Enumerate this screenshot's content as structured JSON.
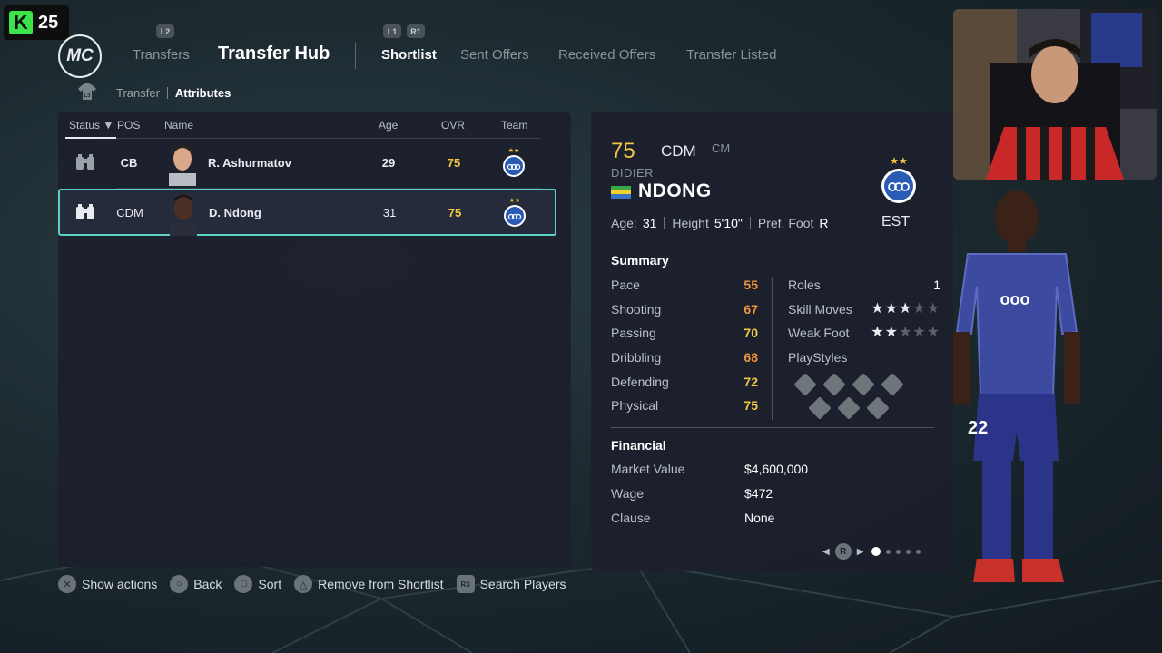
{
  "overlay": {
    "badge_number": "25"
  },
  "header": {
    "logo": "MC",
    "hint_left": "L2",
    "nav_transfers": "Transfers",
    "nav_hub": "Transfer Hub",
    "hint_l1": "L1",
    "hint_r1": "R1",
    "tabs": [
      {
        "label": "Shortlist"
      },
      {
        "label": "Sent Offers"
      },
      {
        "label": "Received Offers"
      },
      {
        "label": "Transfer Listed"
      }
    ],
    "breadcrumb_hint": "L3",
    "breadcrumb": [
      "Transfer",
      "Attributes"
    ]
  },
  "list": {
    "columns": {
      "status": "Status",
      "pos": "POS",
      "name": "Name",
      "age": "Age",
      "ovr": "OVR",
      "team": "Team"
    },
    "rows": [
      {
        "pos": "CB",
        "name": "R. Ashurmatov",
        "age": "29",
        "ovr": "75"
      },
      {
        "pos": "CDM",
        "name": "D. Ndong",
        "age": "31",
        "ovr": "75"
      }
    ]
  },
  "player": {
    "ovr": "75",
    "pos": "CDM",
    "alt_pos": "CM",
    "first_name": "DIDIER",
    "last_name": "NDONG",
    "age_label": "Age:",
    "age": "31",
    "height_label": "Height",
    "height": "5'10\"",
    "foot_label": "Pref. Foot",
    "foot": "R",
    "club": "EST",
    "shirt_number": "22",
    "summary_title": "Summary",
    "stats": [
      {
        "label": "Pace",
        "value": "55",
        "color": "#f0923a"
      },
      {
        "label": "Shooting",
        "value": "67",
        "color": "#f0923a"
      },
      {
        "label": "Passing",
        "value": "70",
        "color": "#f4c842"
      },
      {
        "label": "Dribbling",
        "value": "68",
        "color": "#f0923a"
      },
      {
        "label": "Defending",
        "value": "72",
        "color": "#f4c842"
      },
      {
        "label": "Physical",
        "value": "75",
        "color": "#f4c842"
      }
    ],
    "roles_label": "Roles",
    "roles_value": "1",
    "skill_moves_label": "Skill Moves",
    "skill_moves": 3,
    "weak_foot_label": "Weak Foot",
    "weak_foot": 2,
    "star_max": 5,
    "playstyles_label": "PlayStyles",
    "financial_title": "Financial",
    "financial": [
      {
        "label": "Market Value",
        "value": "$4,600,000"
      },
      {
        "label": "Wage",
        "value": "$472"
      },
      {
        "label": "Clause",
        "value": "None"
      }
    ],
    "pager_hint": "R",
    "pager_pages": 5,
    "pager_current": 1
  },
  "footer": [
    {
      "icon": "cross-button-icon",
      "label": "Show actions"
    },
    {
      "icon": "circle-button-icon",
      "label": "Back"
    },
    {
      "icon": "square-button-icon",
      "label": "Sort"
    },
    {
      "icon": "triangle-button-icon",
      "label": "Remove from Shortlist"
    },
    {
      "icon": "r3-button-icon",
      "glyph": "R3",
      "label": "Search Players"
    }
  ],
  "colors": {
    "accent_select": "#5ad1c4",
    "ovr_gold": "#f4c842",
    "stat_orange": "#f0923a",
    "panel": "#1c202c",
    "club_blue": "#2a5bb5"
  }
}
